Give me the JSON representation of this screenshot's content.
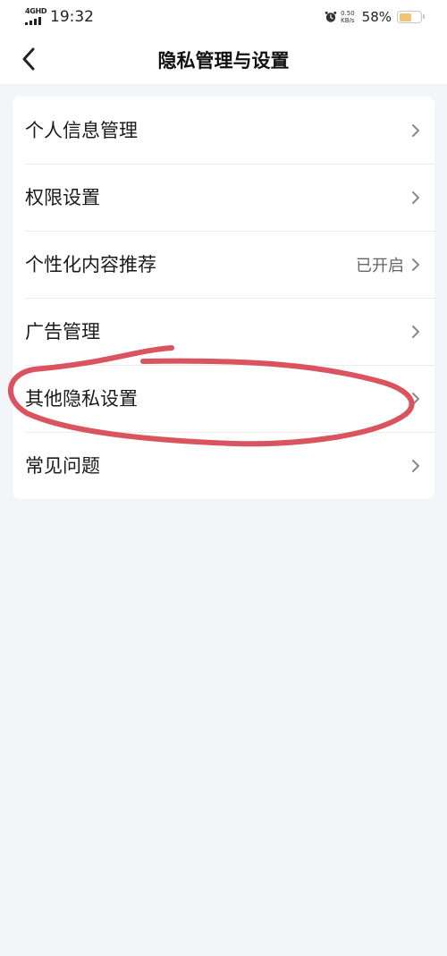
{
  "status_bar": {
    "network_type": "4GHD",
    "time": "19:32",
    "speed_value": "0.50",
    "speed_unit": "KB/s",
    "battery_percent": "58%",
    "battery_level": 0.58
  },
  "nav": {
    "title": "隐私管理与设置",
    "back_icon": "chevron-left-icon"
  },
  "menu": {
    "items": [
      {
        "label": "个人信息管理",
        "value": ""
      },
      {
        "label": "权限设置",
        "value": ""
      },
      {
        "label": "个性化内容推荐",
        "value": "已开启"
      },
      {
        "label": "广告管理",
        "value": ""
      },
      {
        "label": "其他隐私设置",
        "value": ""
      },
      {
        "label": "常见问题",
        "value": ""
      }
    ]
  },
  "colors": {
    "background": "#f4f5f9",
    "card": "#ffffff",
    "annotation_stroke": "#d9545f",
    "chevron": "#888888"
  }
}
